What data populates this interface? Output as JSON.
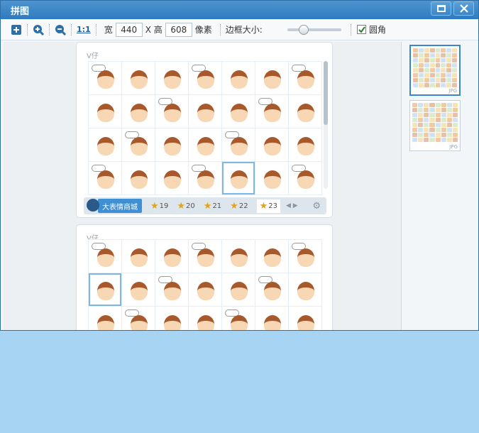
{
  "window": {
    "title": "拼图"
  },
  "toolbar": {
    "one_to_one": "1:1",
    "width_label": "宽",
    "width_value": "440",
    "height_label": "X 高",
    "height_value": "608",
    "unit_label": "像素",
    "border_label": "边框大小:",
    "border_slider_level": 0.25,
    "rounded_label": "圆角",
    "rounded_checked": true
  },
  "preview": {
    "panel1": {
      "tag": "V仔",
      "store_label": "大表情商城",
      "packages": [
        "19",
        "20",
        "21",
        "22",
        "23"
      ]
    },
    "panel2": {
      "tag": "V仔"
    }
  },
  "thumbs": [
    {
      "ext": "JPG",
      "selected": true
    },
    {
      "ext": "JPG",
      "selected": false
    }
  ],
  "colors": {
    "titlebar": "#3a86c8",
    "desktop": "#a8d4f4",
    "accent": "#3a86cc"
  }
}
